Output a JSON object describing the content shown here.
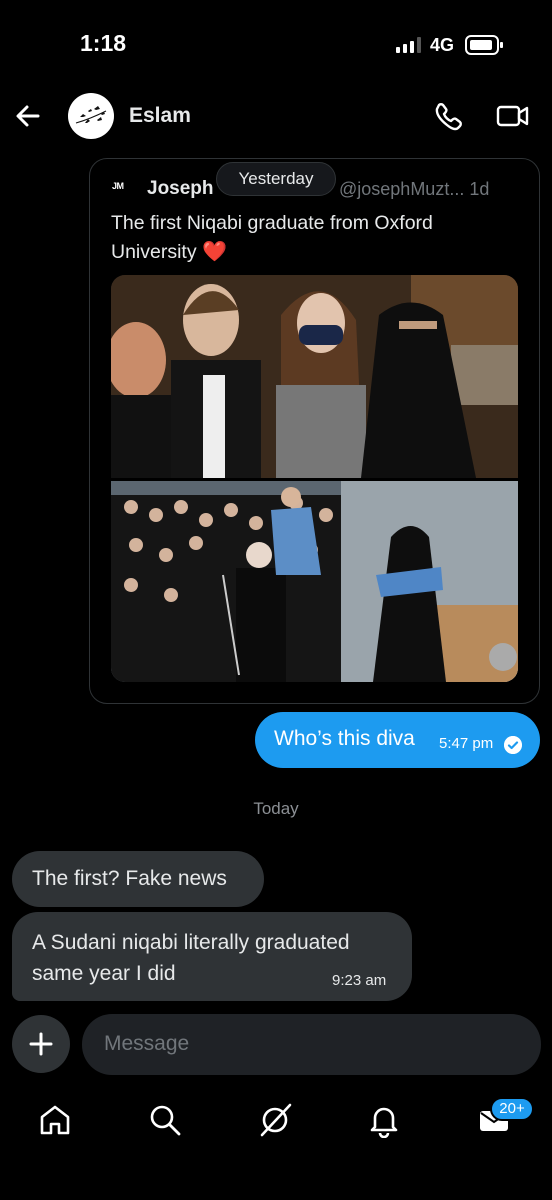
{
  "status_bar": {
    "time": "1:18",
    "network": "4G"
  },
  "header": {
    "name": "Eslam",
    "icons": [
      "back-arrow-icon",
      "phone-icon",
      "video-icon"
    ]
  },
  "shared_post": {
    "logo_text": "JM",
    "author": "Joseph",
    "handle": "@josephMuzt...  1d",
    "text": "The first Niqabi graduate from Oxford University",
    "emoji": "❤️"
  },
  "date_separator_yesterday": "Yesterday",
  "outgoing_message": {
    "text": "Who’s this diva",
    "time": "5:47 pm"
  },
  "date_separator_today": "Today",
  "incoming_messages": [
    {
      "text": "The first? Fake news"
    },
    {
      "text": "A Sudani niqabi literally graduated same year I did",
      "time": "9:23 am"
    }
  ],
  "composer": {
    "placeholder": "Message"
  },
  "bottom_nav": {
    "items": [
      "home-icon",
      "search-icon",
      "grok-icon",
      "notifications-icon",
      "messages-icon"
    ],
    "messages_badge": "20+"
  },
  "colors": {
    "background": "#000000",
    "accent": "#1d9bf0",
    "bubble_incoming": "#2f3336",
    "text_primary": "#e7e9ea",
    "text_secondary": "#71767b"
  }
}
